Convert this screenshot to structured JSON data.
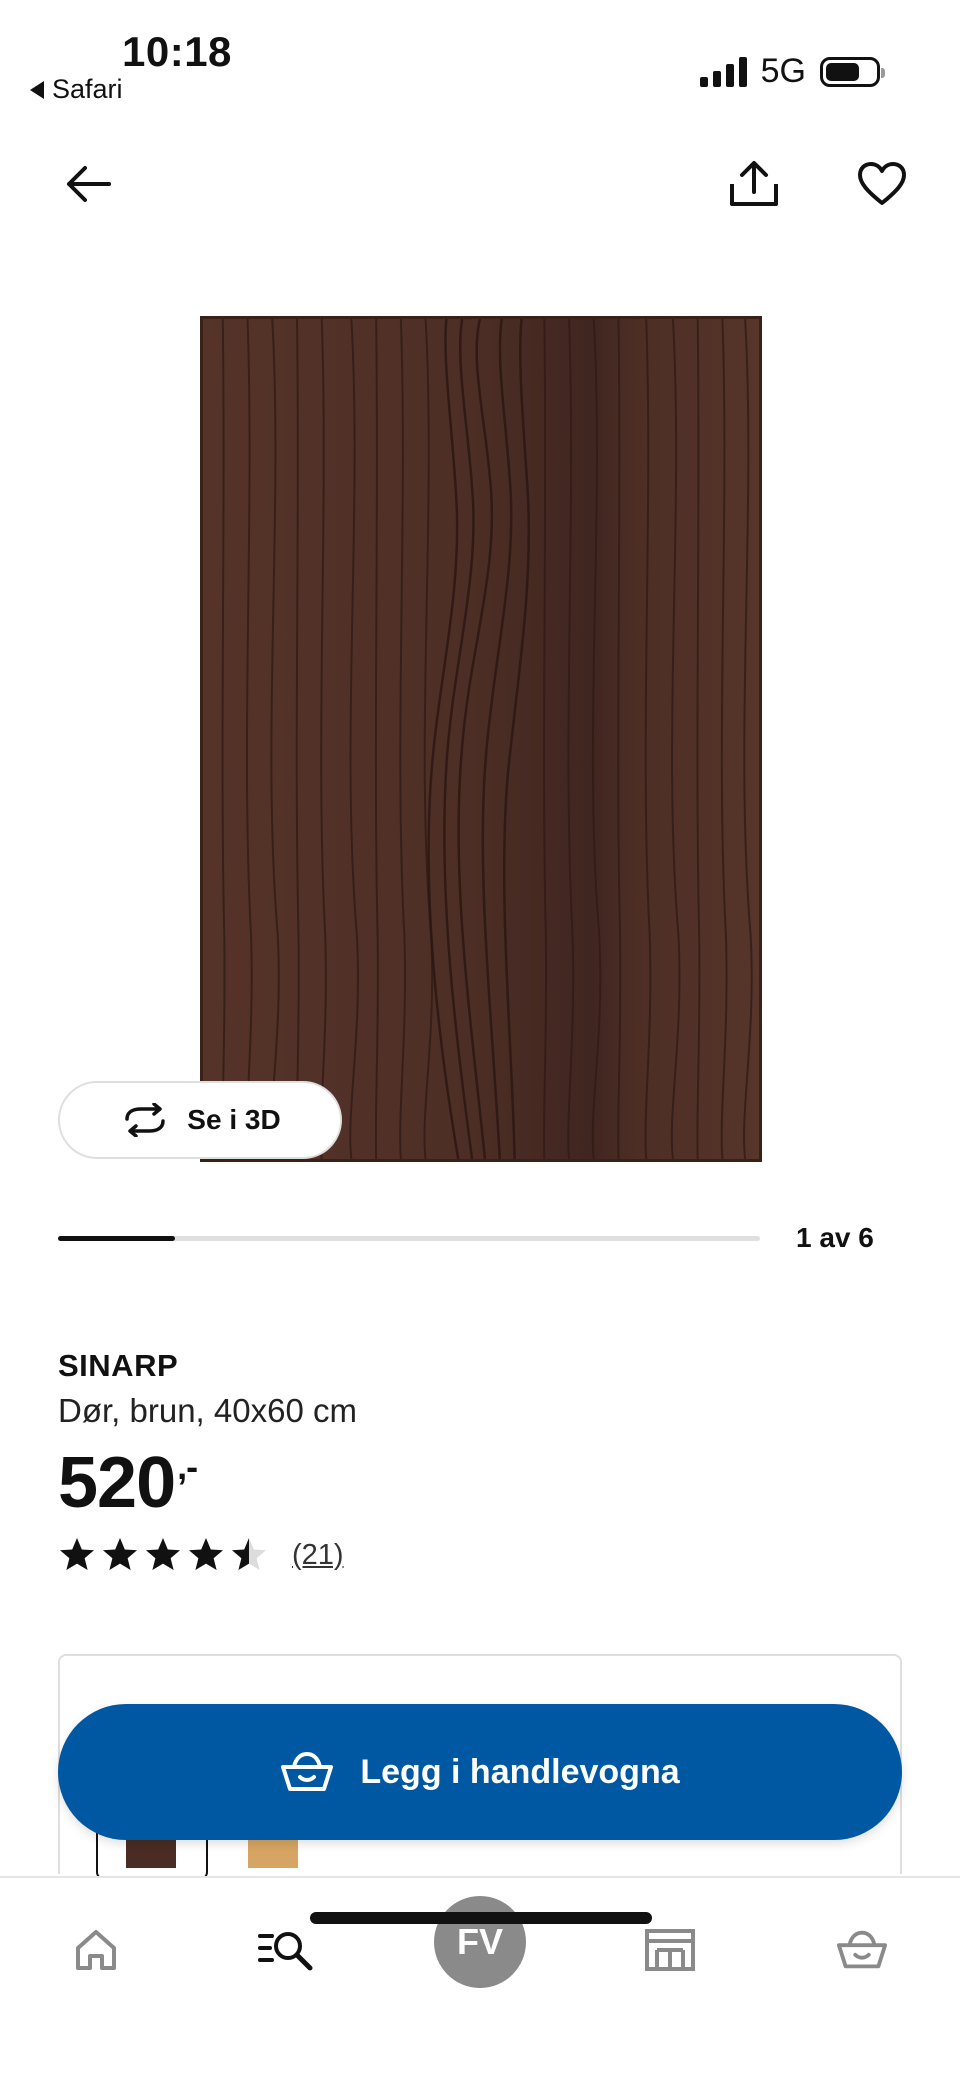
{
  "status_bar": {
    "time": "10:18",
    "back_app": "Safari",
    "network": "5G",
    "battery_level": 0.68
  },
  "nav": {
    "back_icon": "arrow-left-icon",
    "share_icon": "share-icon",
    "favorite_icon": "heart-icon"
  },
  "product": {
    "image_alt_color": "#4a2c24",
    "view_3d_label": "Se i 3D",
    "pager_text": "1 av 6",
    "carousel_position": 1,
    "carousel_total": 6,
    "name": "SINARP",
    "description": "Dør, brun, 40x60 cm",
    "price": "520",
    "price_suffix": ",-",
    "rating": 4.5,
    "review_count": "(21)"
  },
  "variants": [
    {
      "color": "#4a2c24",
      "selected": true
    },
    {
      "color": "#d7a563",
      "selected": false
    }
  ],
  "cta": {
    "label": "Legg i handlevogna",
    "icon": "basket-icon",
    "color": "#0058a3"
  },
  "bottom_nav": {
    "items": [
      {
        "icon": "home-icon"
      },
      {
        "icon": "search-list-icon"
      },
      {
        "label": "FV"
      },
      {
        "icon": "store-icon"
      },
      {
        "icon": "basket-icon"
      }
    ]
  }
}
